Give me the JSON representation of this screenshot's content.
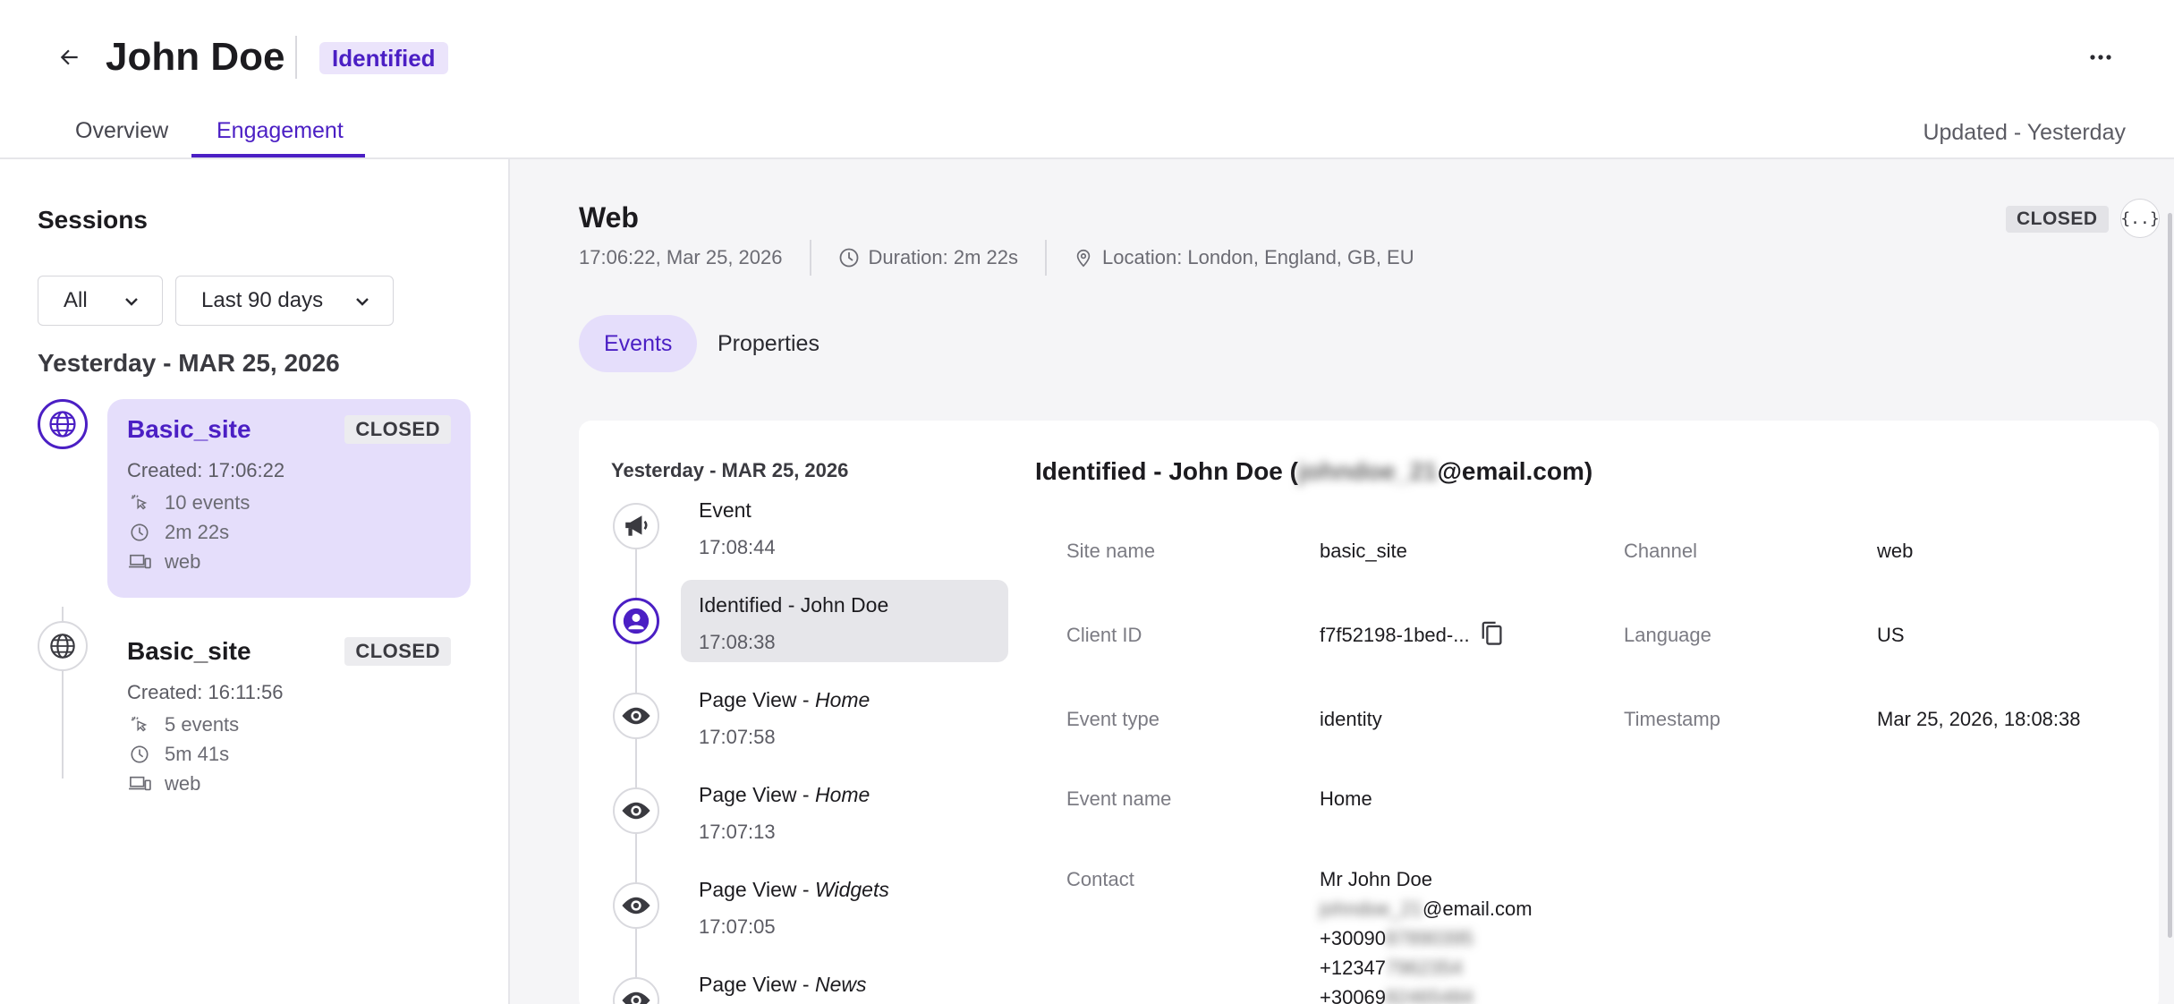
{
  "header": {
    "title": "John Doe",
    "status": "Identified",
    "tabs": [
      "Overview",
      "Engagement"
    ],
    "updated": "Updated - Yesterday"
  },
  "sidebar": {
    "title": "Sessions",
    "filter_type": "All",
    "filter_range": "Last 90 days",
    "date_heading": "Yesterday - MAR 25, 2026",
    "sessions": [
      {
        "name": "Basic_site",
        "status": "CLOSED",
        "created": "Created: 17:06:22",
        "events": "10 events",
        "duration": "2m 22s",
        "channel": "web",
        "icon": "globe-icon"
      },
      {
        "name": "Basic_site",
        "status": "CLOSED",
        "created": "Created: 16:11:56",
        "events": "5 events",
        "duration": "5m 41s",
        "channel": "web",
        "icon": "globe-icon"
      }
    ]
  },
  "main": {
    "channel": "Web",
    "datetime": "17:06:22, Mar 25, 2026",
    "duration": "Duration: 2m 22s",
    "location": "Location: London, England, GB, EU",
    "status": "CLOSED",
    "json_label": "{..}",
    "subtabs": [
      "Events",
      "Properties"
    ],
    "events_date": "Yesterday - MAR 25, 2026",
    "events": [
      {
        "name": "Event",
        "page": "",
        "time": "17:08:44",
        "icon": "megaphone-icon"
      },
      {
        "name": "Identified - John Doe",
        "page": "",
        "time": "17:08:38",
        "icon": "person-icon"
      },
      {
        "name": "Page View - ",
        "page": "Home",
        "time": "17:07:58",
        "icon": "eye-icon"
      },
      {
        "name": "Page View - ",
        "page": "Home",
        "time": "17:07:13",
        "icon": "eye-icon"
      },
      {
        "name": "Page View - ",
        "page": "Widgets",
        "time": "17:07:05",
        "icon": "eye-icon"
      },
      {
        "name": "Page View - ",
        "page": "News",
        "time": "",
        "icon": "eye-icon"
      }
    ],
    "detail": {
      "title_prefix": "Identified - John Doe (",
      "title_blurred": "johndoe_21",
      "title_suffix": "@email.com)",
      "site_name_label": "Site name",
      "site_name": "basic_site",
      "channel_label": "Channel",
      "channel": "web",
      "client_id_label": "Client ID",
      "client_id": "f7f52198-1bed-...",
      "language_label": "Language",
      "language": "US",
      "event_type_label": "Event type",
      "event_type": "identity",
      "timestamp_label": "Timestamp",
      "timestamp": "Mar 25, 2026, 18:08:38",
      "event_name_label": "Event name",
      "event_name": "Home",
      "contact_label": "Contact",
      "contact_name": "Mr John Doe",
      "contact_email_blurred": "johndoe_21",
      "contact_email_suffix": "@email.com",
      "phones": [
        {
          "visible": "+30090",
          "blurred": "87890395"
        },
        {
          "visible": "+12347",
          "blurred": "7962354"
        },
        {
          "visible": "+30069",
          "blurred": "82465484"
        }
      ]
    }
  }
}
